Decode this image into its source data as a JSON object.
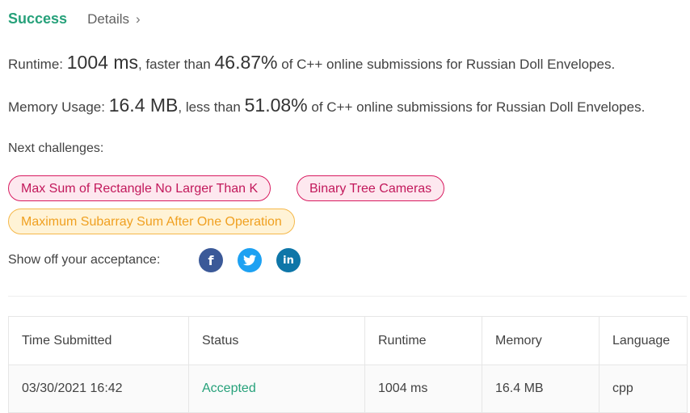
{
  "header": {
    "status": "Success",
    "details_label": "Details",
    "details_chevron": "›"
  },
  "runtime": {
    "label": "Runtime:",
    "value": "1004 ms",
    "middle": ", faster than",
    "percent": "46.87%",
    "suffix": "of C++ online submissions for Russian Doll Envelopes."
  },
  "memory": {
    "label": "Memory Usage:",
    "value": "16.4 MB",
    "middle": ", less than",
    "percent": "51.08%",
    "suffix": "of C++ online submissions for Russian Doll Envelopes."
  },
  "next": {
    "label": "Next challenges:",
    "challenges": [
      {
        "title": "Max Sum of Rectangle No Larger Than K",
        "difficulty": "hard"
      },
      {
        "title": "Binary Tree Cameras",
        "difficulty": "hard"
      },
      {
        "title": "Maximum Subarray Sum After One Operation",
        "difficulty": "medium"
      }
    ]
  },
  "share": {
    "label": "Show off your acceptance:",
    "icons": [
      "facebook-icon",
      "twitter-icon",
      "linkedin-icon"
    ],
    "fb_glyph": "f",
    "tw_glyph": "🐦",
    "li_glyph": "in"
  },
  "colors": {
    "accent": "#26a17a",
    "hard": "#d81b60",
    "medium": "#f0a020",
    "facebook": "#3b5998",
    "twitter": "#1da1f2",
    "linkedin": "#0e76a8"
  },
  "table": {
    "headers": [
      "Time Submitted",
      "Status",
      "Runtime",
      "Memory",
      "Language"
    ],
    "rows": [
      [
        "03/30/2021 16:42",
        "Accepted",
        "1004 ms",
        "16.4 MB",
        "cpp"
      ]
    ]
  }
}
